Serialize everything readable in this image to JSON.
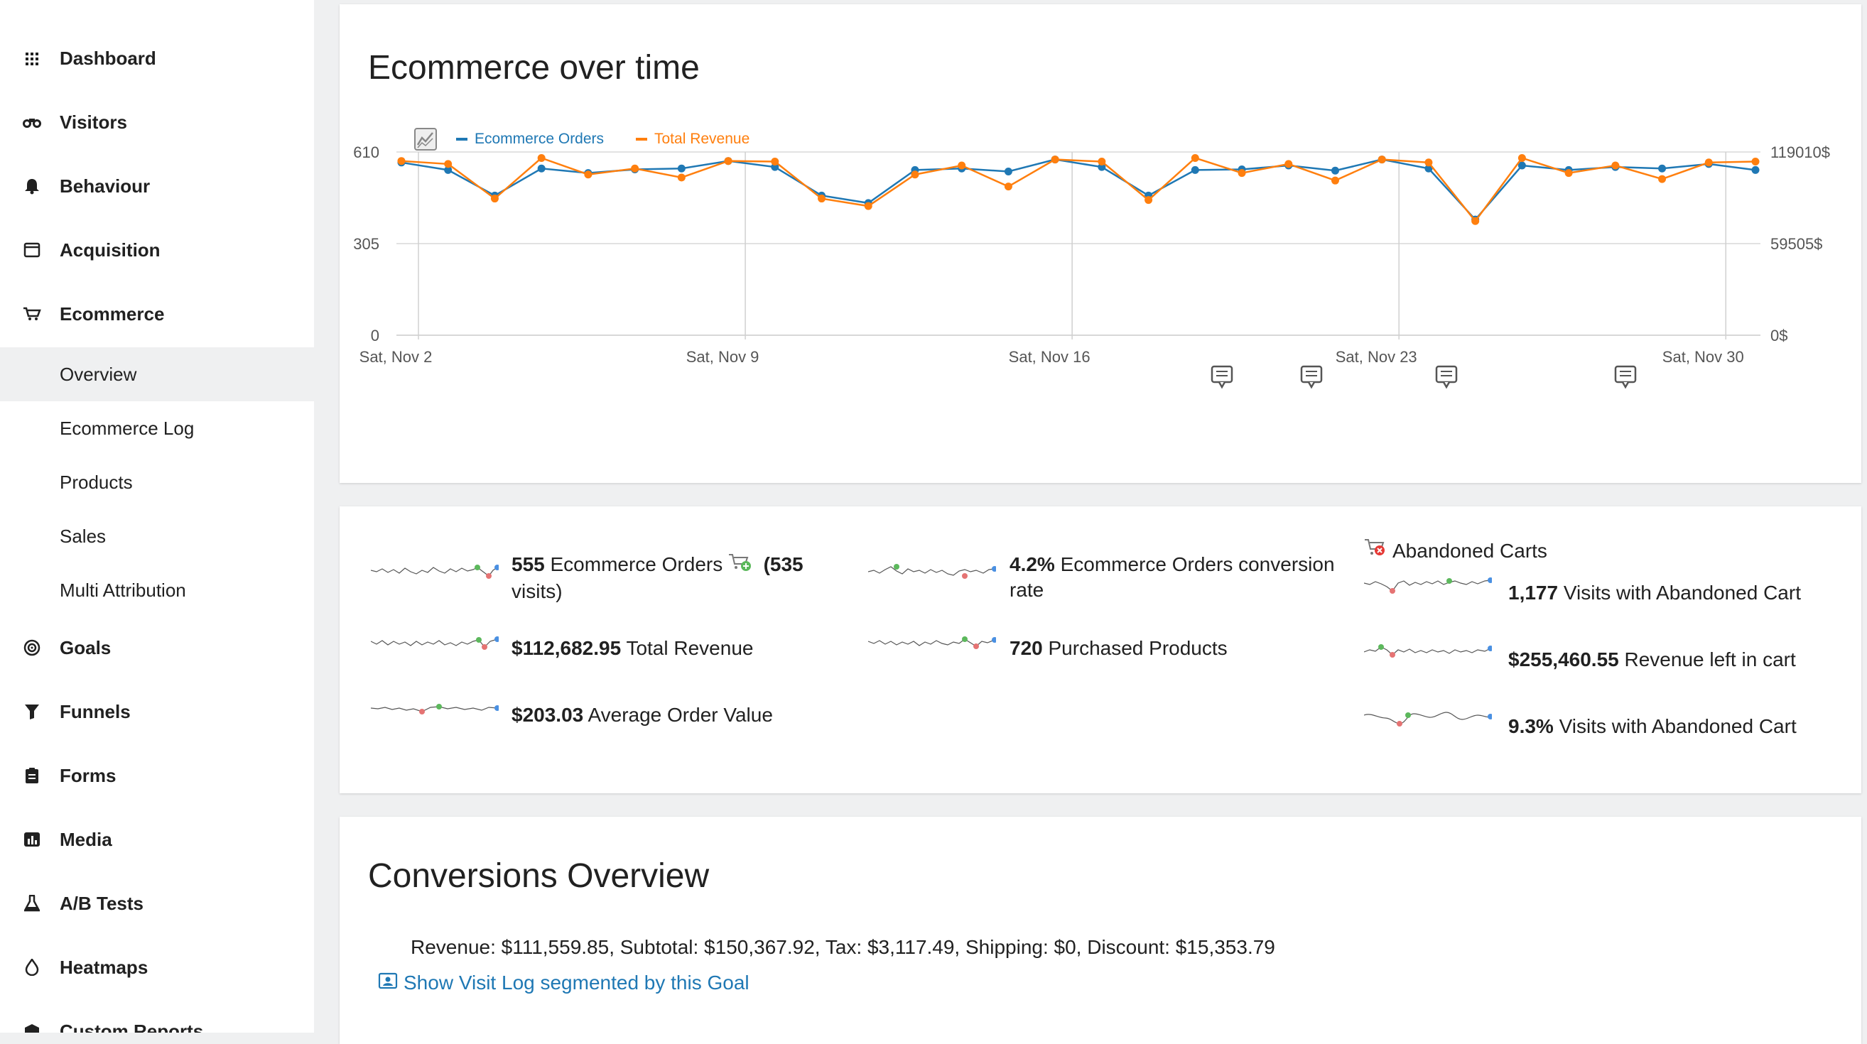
{
  "sidebar": {
    "items": [
      {
        "label": "Dashboard",
        "icon": "grid-icon"
      },
      {
        "label": "Visitors",
        "icon": "binoculars-icon"
      },
      {
        "label": "Behaviour",
        "icon": "bell-icon"
      },
      {
        "label": "Acquisition",
        "icon": "browser-window-icon"
      },
      {
        "label": "Ecommerce",
        "icon": "cart-icon"
      }
    ],
    "ecommerce_subitems": [
      {
        "label": "Overview",
        "active": true
      },
      {
        "label": "Ecommerce Log"
      },
      {
        "label": "Products"
      },
      {
        "label": "Sales"
      },
      {
        "label": "Multi Attribution"
      }
    ],
    "items_after": [
      {
        "label": "Goals",
        "icon": "target-icon"
      },
      {
        "label": "Funnels",
        "icon": "funnel-icon"
      },
      {
        "label": "Forms",
        "icon": "clipboard-icon"
      },
      {
        "label": "Media",
        "icon": "media-chart-icon"
      },
      {
        "label": "A/B Tests",
        "icon": "flask-icon"
      },
      {
        "label": "Heatmaps",
        "icon": "flame-icon"
      },
      {
        "label": "Custom Reports",
        "icon": "box-icon"
      }
    ]
  },
  "evolution": {
    "title": "Ecommerce over time",
    "chart_data": {
      "type": "line",
      "x_ticks": [
        "Sat, Nov 2",
        "Sat, Nov 9",
        "Sat, Nov 16",
        "Sat, Nov 23",
        "Sat, Nov 30"
      ],
      "y_left_ticks": [
        "610",
        "305",
        "0"
      ],
      "y_right_ticks": [
        "119010$",
        "59505$",
        "0$"
      ],
      "ylim_left": [
        0,
        610
      ],
      "ylim_right": [
        0,
        119010
      ],
      "grid": true,
      "legend_position": "top-left",
      "x_range": [
        "2024-11-02",
        "2024-12-01"
      ],
      "series": [
        {
          "name": "Ecommerce Orders",
          "color": "#1f78b4",
          "axis": "left",
          "values": [
            575,
            550,
            465,
            555,
            540,
            552,
            555,
            580,
            560,
            465,
            440,
            550,
            555,
            545,
            585,
            560,
            465,
            550,
            552,
            565,
            548,
            585,
            555,
            385,
            565,
            550,
            560,
            555,
            570,
            550
          ]
        },
        {
          "name": "Total Revenue",
          "color": "#ff7f0e",
          "axis": "left",
          "values": [
            580,
            570,
            455,
            590,
            535,
            555,
            525,
            580,
            578,
            455,
            430,
            535,
            565,
            495,
            585,
            578,
            450,
            590,
            540,
            570,
            515,
            585,
            575,
            380,
            590,
            540,
            565,
            520,
            575,
            578
          ]
        }
      ],
      "annotation_icons": [
        "annotation-icon",
        "annotation-icon",
        "annotation-icon",
        "annotation-icon"
      ]
    }
  },
  "metrics": {
    "col1": [
      {
        "value": "555",
        "label": "Ecommerce Orders",
        "extra": "(535",
        "extra2": "visits)"
      },
      {
        "value": "$112,682.95",
        "label": "Total Revenue"
      },
      {
        "value": "$203.03",
        "label": "Average Order Value"
      }
    ],
    "col2": [
      {
        "value": "4.2%",
        "label": "Ecommerce Orders conversion",
        "label2": "rate"
      },
      {
        "value": "720",
        "label": "Purchased Products"
      }
    ],
    "col3_header": "Abandoned Carts",
    "col3": [
      {
        "value": "1,177",
        "label": "Visits with Abandoned Cart"
      },
      {
        "value": "$255,460.55",
        "label": "Revenue left in cart"
      },
      {
        "value": "9.3%",
        "label": "Visits with Abandoned Cart"
      }
    ]
  },
  "conversions": {
    "title": "Conversions Overview",
    "summary": "Revenue: $111,559.85, Subtotal: $150,367.92, Tax: $3,117.49, Shipping: $0, Discount: $15,353.79",
    "link": "Show Visit Log segmented by this Goal"
  },
  "colors": {
    "orders": "#1f78b4",
    "revenue": "#ff7f0e",
    "link": "#1f78b4"
  }
}
